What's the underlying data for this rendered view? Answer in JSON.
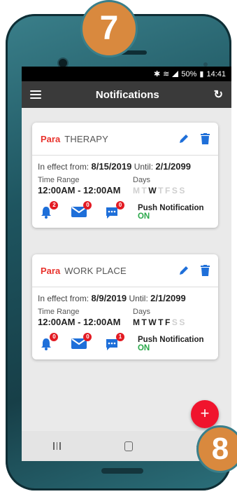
{
  "step_badges": {
    "top": "7",
    "bottom": "8"
  },
  "statusbar": {
    "icons": [
      "bluetooth-icon",
      "wifi-icon",
      "signal-icon",
      "battery-icon"
    ],
    "battery": "50%",
    "time": "14:41"
  },
  "appbar": {
    "title": "Notifications"
  },
  "cards": [
    {
      "tag": "Para",
      "name": "THERAPY",
      "effect_label": "In effect from:",
      "from": "8/15/2019",
      "until_label": "Until:",
      "until": "2/1/2099",
      "time_range_label": "Time Range",
      "time_range": "12:00AM - 12:00AM",
      "days_label": "Days",
      "days": [
        {
          "d": "M",
          "state": "off"
        },
        {
          "d": "T",
          "state": "off"
        },
        {
          "d": "W",
          "state": "on"
        },
        {
          "d": "T",
          "state": "off"
        },
        {
          "d": "F",
          "state": "off"
        },
        {
          "d": "S",
          "state": "off"
        },
        {
          "d": "S",
          "state": "off"
        }
      ],
      "badges": {
        "alarm": "2",
        "email": "0",
        "sms": "0"
      },
      "push_label": "Push Notification",
      "push_state": "ON"
    },
    {
      "tag": "Para",
      "name": "WORK PLACE",
      "effect_label": "In effect from:",
      "from": "8/9/2019",
      "until_label": "Until:",
      "until": "2/1/2099",
      "time_range_label": "Time Range",
      "time_range": "12:00AM - 12:00AM",
      "days_label": "Days",
      "days": [
        {
          "d": "M",
          "state": "on"
        },
        {
          "d": "T",
          "state": "on"
        },
        {
          "d": "W",
          "state": "on"
        },
        {
          "d": "T",
          "state": "on"
        },
        {
          "d": "F",
          "state": "on"
        },
        {
          "d": "S",
          "state": "off"
        },
        {
          "d": "S",
          "state": "off"
        }
      ],
      "badges": {
        "alarm": "0",
        "email": "0",
        "sms": "1"
      },
      "push_label": "Push Notification",
      "push_state": "ON"
    }
  ],
  "fab": {
    "label": "+"
  },
  "colors": {
    "accent_blue": "#1e6fd9",
    "para_red": "#e8332d",
    "badge_red": "#e31b23",
    "on_green": "#2aa84a",
    "fab_red": "#f0142d"
  }
}
